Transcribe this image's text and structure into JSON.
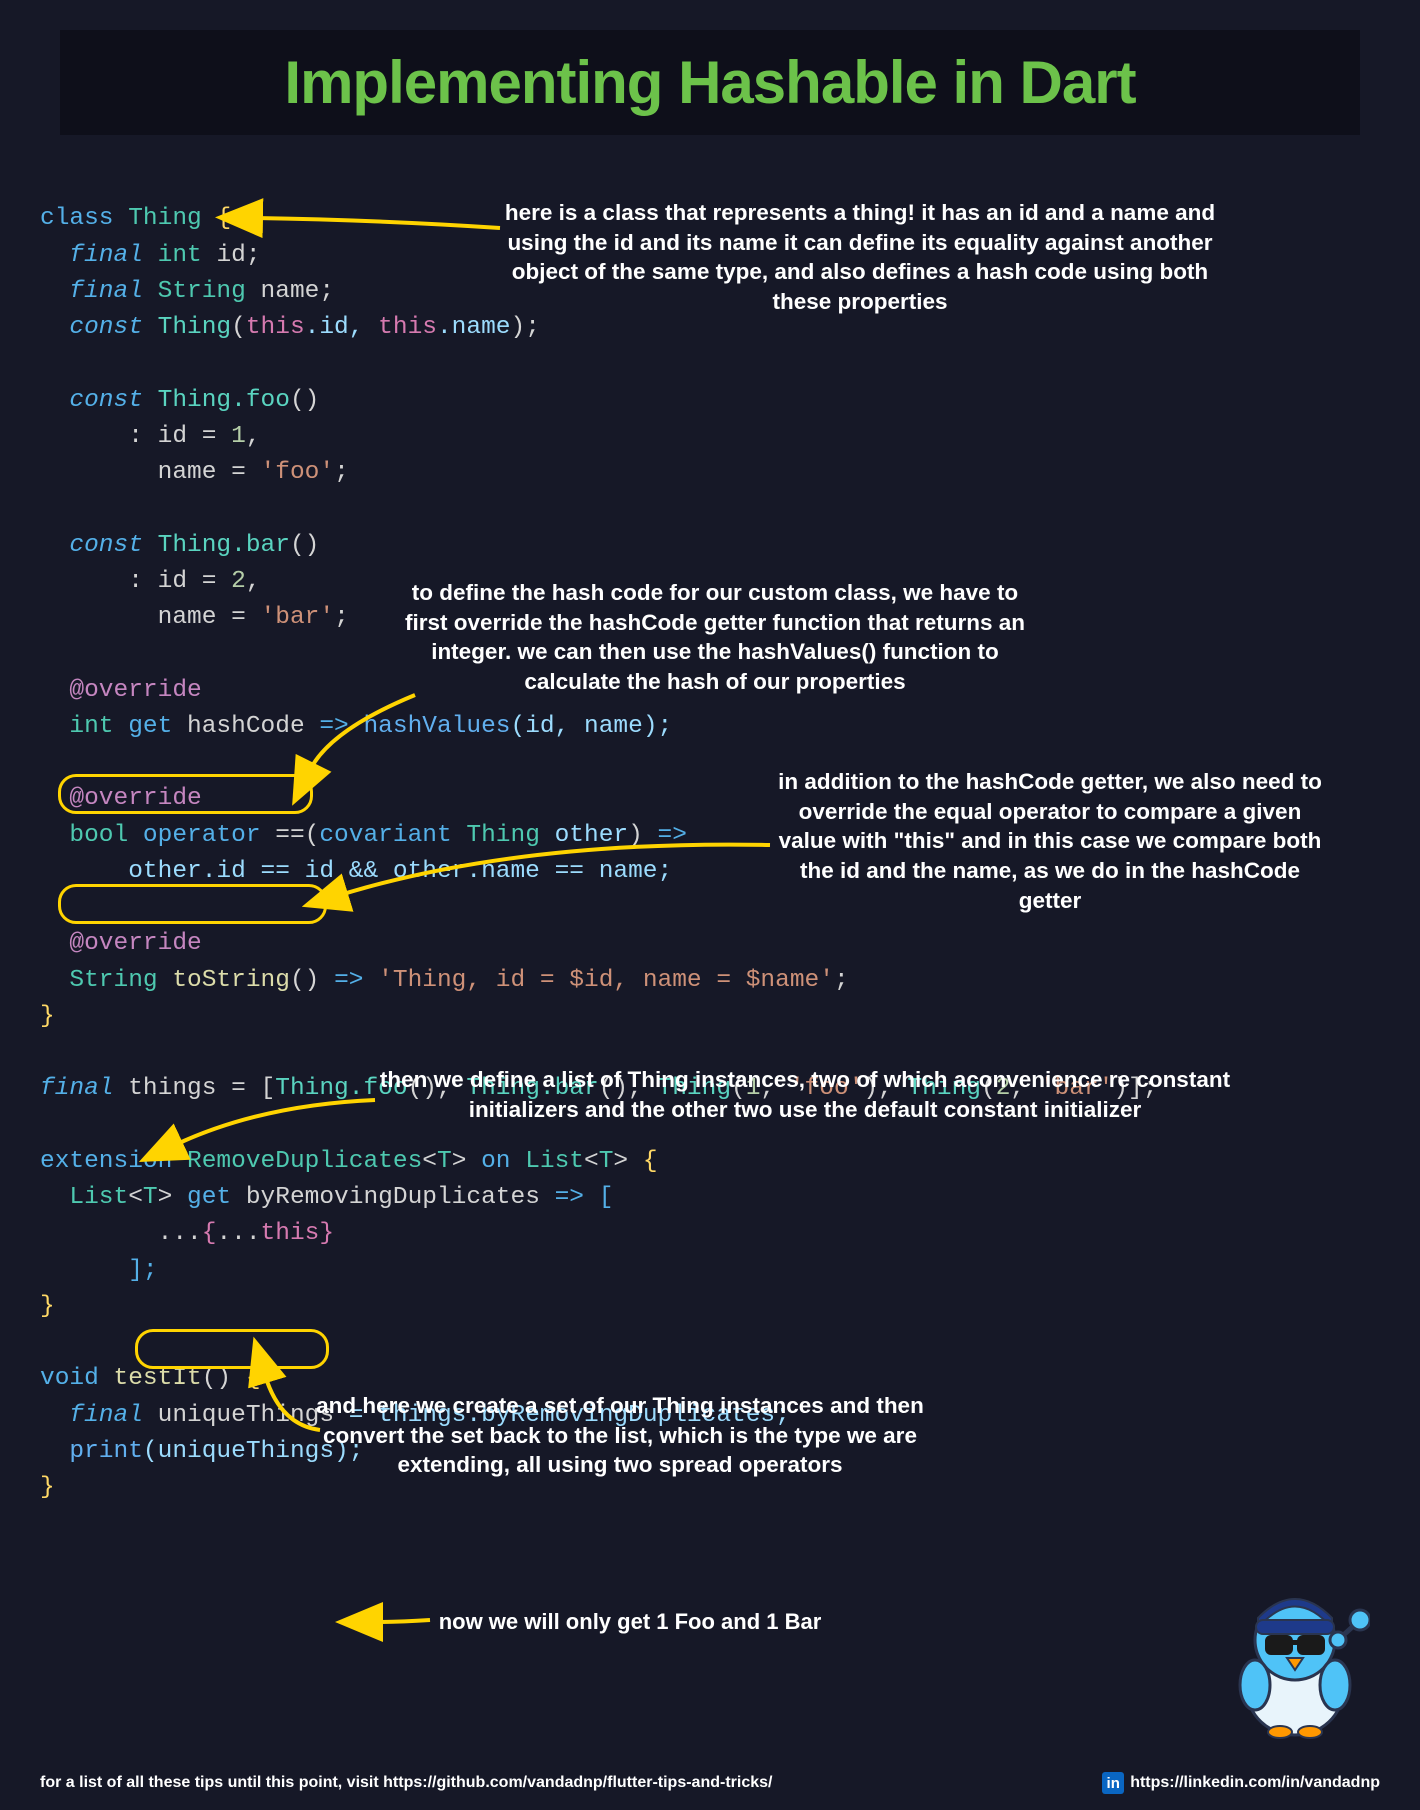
{
  "title": "Implementing Hashable in Dart",
  "code": {
    "l1_class": "class",
    "l1_type": "Thing",
    "l1_brace": "{",
    "l2_final": "final",
    "l2_int": "int",
    "l2_id": "id",
    "l3_final": "final",
    "l3_string": "String",
    "l3_name": "name",
    "l4_const": "const",
    "l4_thing": "Thing",
    "l4_this1": "this",
    "l4_dot_id": ".id,",
    "l4_this2": "this",
    "l4_dot_name": ".name",
    "l5_const": "const",
    "l5_thing_foo": "Thing.foo",
    "l6_id_eq": ": id =",
    "l6_one": "1",
    "l7_name_eq": "name =",
    "l7_foo_str": "'foo'",
    "l8_const": "const",
    "l8_thing_bar": "Thing.bar",
    "l9_id_eq": ": id =",
    "l9_two": "2",
    "l10_name_eq": "name =",
    "l10_bar_str": "'bar'",
    "l11_override": "@override",
    "l12_int": "int",
    "l12_get": "get",
    "l12_hashcode": "hashCode",
    "l12_arrow": "=>",
    "l12_hashvalues": "hashValues",
    "l12_args": "(id, name);",
    "l13_override": "@override",
    "l14_bool": "bool",
    "l14_operator": "operator",
    "l14_eqeq": "==",
    "l14_covariant": "covariant",
    "l14_thing": "Thing",
    "l14_other": "other",
    "l14_arrow": "=>",
    "l15_body": "other.id == id && other.name == name;",
    "l16_override": "@override",
    "l17_string": "String",
    "l17_tostring": "toString",
    "l17_arrow": "=>",
    "l17_str": "'Thing, id = $id, name = $name'",
    "l18_brace": "}",
    "l19_final": "final",
    "l19_things": "things",
    "l19_eq": "= [",
    "l19_foo": "Thing.foo",
    "l19_bar": "Thing.bar",
    "l19_t1": "Thing",
    "l19_one": "1",
    "l19_foo_s": "'foo'",
    "l19_t2": "Thing",
    "l19_two": "2",
    "l19_bar_s": "'bar'",
    "l19_close": ")];",
    "l20_extension": "extension",
    "l20_name": "RemoveDuplicates",
    "l20_T": "T",
    "l20_on": "on",
    "l20_list": "List",
    "l21_list": "List",
    "l21_T": "T",
    "l21_get": "get",
    "l21_method": "byRemovingDuplicates",
    "l21_arrow": "=> [",
    "l22_spread1": "...",
    "l22_lb": "{",
    "l22_spread2": "...",
    "l22_this": "this",
    "l22_rb": "}",
    "l23_rb": "];",
    "l24_brace": "}",
    "l25_void": "void",
    "l25_fn": "testIt",
    "l25_brace": "{",
    "l26_final": "final",
    "l26_var": "uniqueThings",
    "l26_eq": "= things.byRemovingDuplicates;",
    "l27_print": "print",
    "l27_arg": "(uniqueThings);",
    "l28_brace": "}"
  },
  "annotations": {
    "a1": "here is a class that represents a thing! it has an id and a name and using the id and its name it can define its equality against another object of the same type, and also defines a hash code using both these properties",
    "a2": "to define the hash code for our custom class, we have to first override the hashCode getter function that returns an integer. we can then use the hashValues() function to calculate the hash of our properties",
    "a3": "in addition to the hashCode getter, we also need to override the equal operator to compare a given value with \"this\" and in this case we compare both the id and the name, as we do in the hashCode getter",
    "a4": "then we define a list of Thing instances, two of which aconvenience re constant initializers and the other two use the default constant initializer",
    "a5": "and here we create a set of our Thing instances and then convert the set back to the list, which is the type we are extending, all using two spread operators",
    "a6": "now we will only get 1 Foo and 1 Bar"
  },
  "footer": {
    "left": "for a list of all these tips until this point, visit https://github.com/vandadnp/flutter-tips-and-tricks/",
    "right": "https://linkedin.com/in/vandadnp",
    "linkedin_glyph": "in"
  }
}
